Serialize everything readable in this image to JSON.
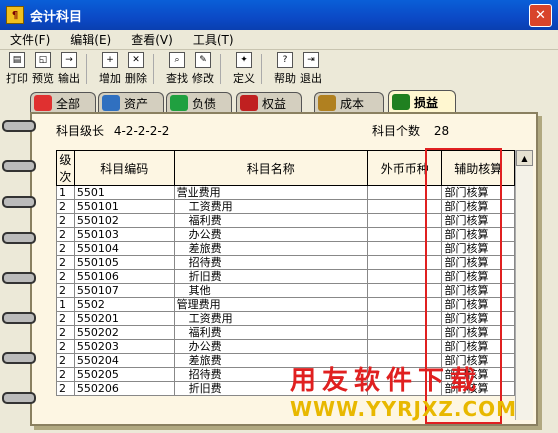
{
  "window": {
    "title": "会计科目"
  },
  "menu": [
    {
      "label": "文件(F)"
    },
    {
      "label": "编辑(E)"
    },
    {
      "label": "查看(V)"
    },
    {
      "label": "工具(T)"
    }
  ],
  "toolbar": [
    {
      "label": "打印",
      "icon": "printer-icon"
    },
    {
      "label": "预览",
      "icon": "preview-icon"
    },
    {
      "label": "输出",
      "icon": "export-icon"
    },
    {
      "label": "增加",
      "icon": "add-icon"
    },
    {
      "label": "删除",
      "icon": "delete-icon"
    },
    {
      "label": "查找",
      "icon": "find-icon"
    },
    {
      "label": "修改",
      "icon": "edit-icon"
    },
    {
      "label": "定义",
      "icon": "define-icon"
    },
    {
      "label": "帮助",
      "icon": "help-icon"
    },
    {
      "label": "退出",
      "icon": "exit-icon"
    }
  ],
  "tabs": [
    {
      "label": "全部",
      "color": "#e03030"
    },
    {
      "label": "资产",
      "color": "#3070c0"
    },
    {
      "label": "负债",
      "color": "#20a040"
    },
    {
      "label": "权益",
      "color": "#c02020"
    },
    {
      "label": "成本",
      "color": "#b08020"
    },
    {
      "label": "损益",
      "color": "#208020",
      "active": true
    }
  ],
  "meta": {
    "level_label": "科目级长",
    "level_value": "4-2-2-2-2",
    "count_label": "科目个数",
    "count_value": "28"
  },
  "columns": [
    "级次",
    "科目编码",
    "科目名称",
    "外币币种",
    "辅助核算"
  ],
  "rows": [
    {
      "level": "1",
      "code": "5501",
      "name": "营业费用",
      "currency": "",
      "aux": "部门核算"
    },
    {
      "level": "2",
      "code": "550101",
      "name": "工资费用",
      "currency": "",
      "aux": "部门核算"
    },
    {
      "level": "2",
      "code": "550102",
      "name": "福利费",
      "currency": "",
      "aux": "部门核算"
    },
    {
      "level": "2",
      "code": "550103",
      "name": "办公费",
      "currency": "",
      "aux": "部门核算"
    },
    {
      "level": "2",
      "code": "550104",
      "name": "差旅费",
      "currency": "",
      "aux": "部门核算"
    },
    {
      "level": "2",
      "code": "550105",
      "name": "招待费",
      "currency": "",
      "aux": "部门核算"
    },
    {
      "level": "2",
      "code": "550106",
      "name": "折旧费",
      "currency": "",
      "aux": "部门核算"
    },
    {
      "level": "2",
      "code": "550107",
      "name": "其他",
      "currency": "",
      "aux": "部门核算"
    },
    {
      "level": "1",
      "code": "5502",
      "name": "管理费用",
      "currency": "",
      "aux": "部门核算"
    },
    {
      "level": "2",
      "code": "550201",
      "name": "工资费用",
      "currency": "",
      "aux": "部门核算"
    },
    {
      "level": "2",
      "code": "550202",
      "name": "福利费",
      "currency": "",
      "aux": "部门核算"
    },
    {
      "level": "2",
      "code": "550203",
      "name": "办公费",
      "currency": "",
      "aux": "部门核算"
    },
    {
      "level": "2",
      "code": "550204",
      "name": "差旅费",
      "currency": "",
      "aux": "部门核算"
    },
    {
      "level": "2",
      "code": "550205",
      "name": "招待费",
      "currency": "",
      "aux": "部门核算"
    },
    {
      "level": "2",
      "code": "550206",
      "name": "折旧费",
      "currency": "",
      "aux": "部门核算"
    }
  ],
  "watermark": {
    "line1": "用友软件下载",
    "line2": "WWW.YYRJXZ.COM"
  }
}
